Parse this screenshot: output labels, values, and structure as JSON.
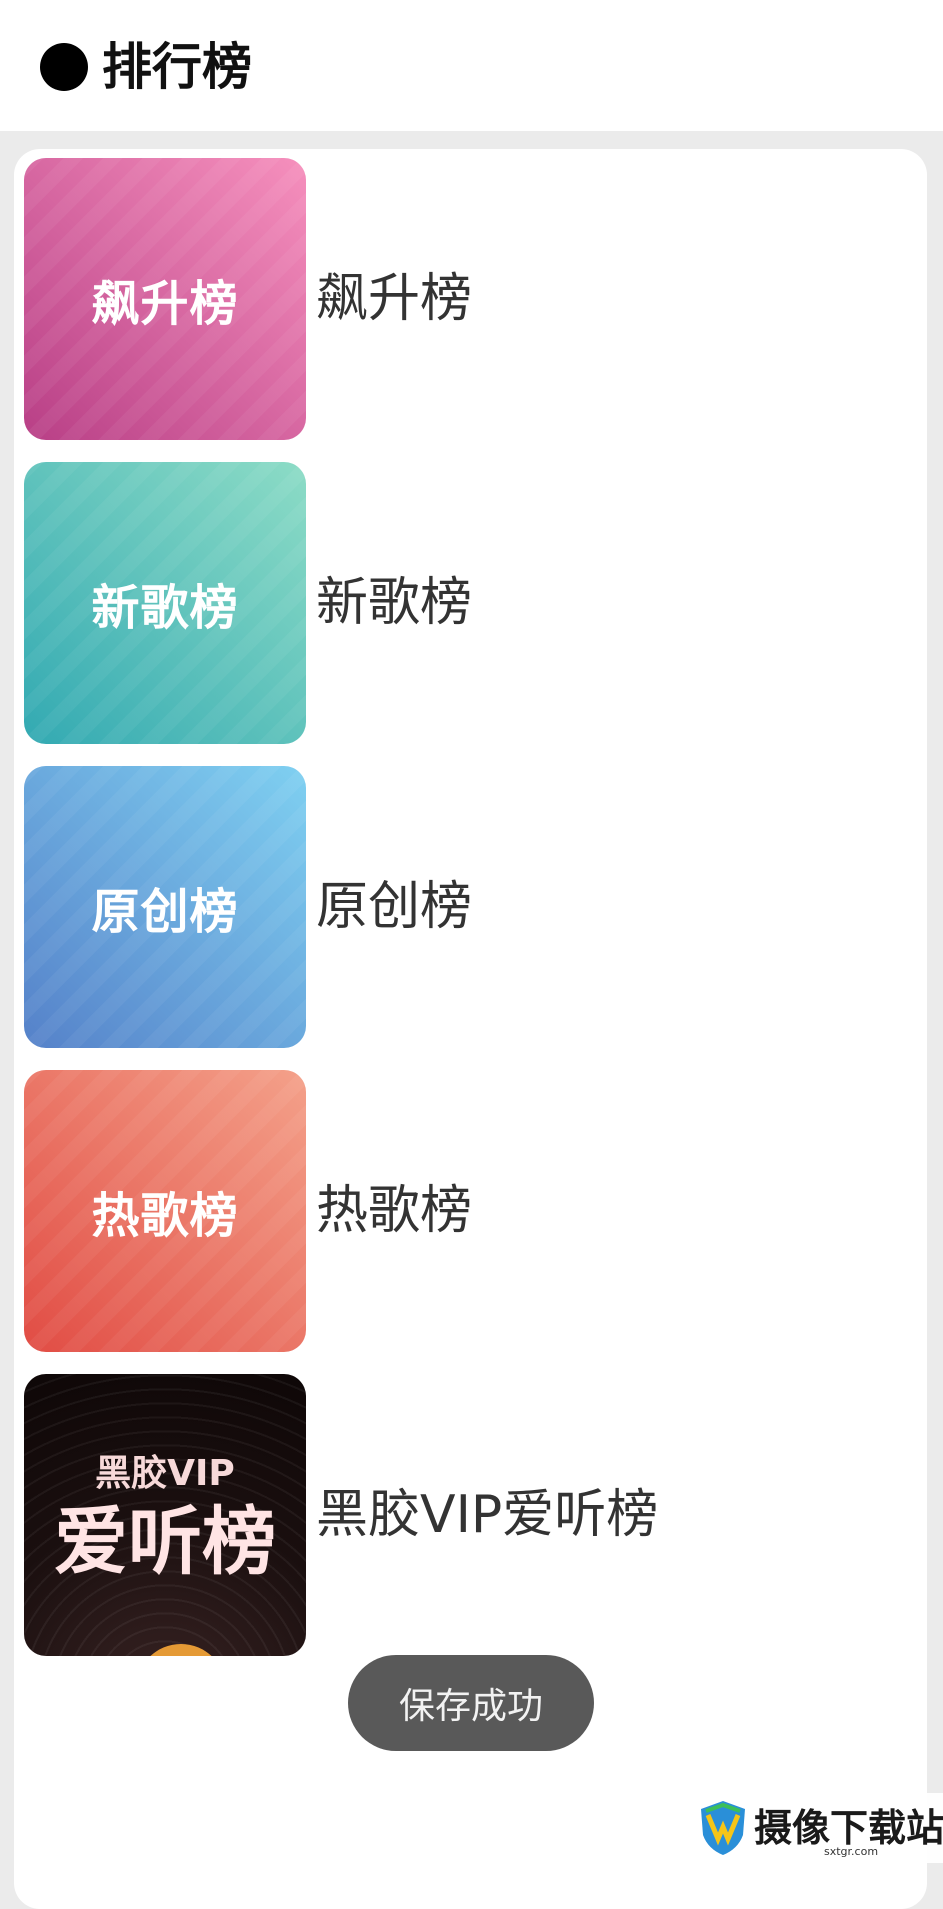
{
  "header": {
    "title": "排行榜"
  },
  "charts": [
    {
      "cover_label": "飙升榜",
      "title": "飙升榜",
      "gradient": [
        "#b83f86",
        "#f690bd"
      ]
    },
    {
      "cover_label": "新歌榜",
      "title": "新歌榜",
      "gradient": [
        "#32a9b2",
        "#8ddcc6"
      ]
    },
    {
      "cover_label": "原创榜",
      "title": "原创榜",
      "gradient": [
        "#5581c9",
        "#7fd0f1"
      ]
    },
    {
      "cover_label": "热歌榜",
      "title": "热歌榜",
      "gradient": [
        "#e14c44",
        "#f4a18a"
      ]
    }
  ],
  "vip_chart": {
    "cover_top": "黑胶VIP",
    "cover_main": "爱听榜",
    "title": "黑胶VIP爱听榜"
  },
  "toast": {
    "message": "保存成功"
  },
  "watermark": {
    "text": "摄像下载站",
    "url": "sxtgr.com"
  }
}
